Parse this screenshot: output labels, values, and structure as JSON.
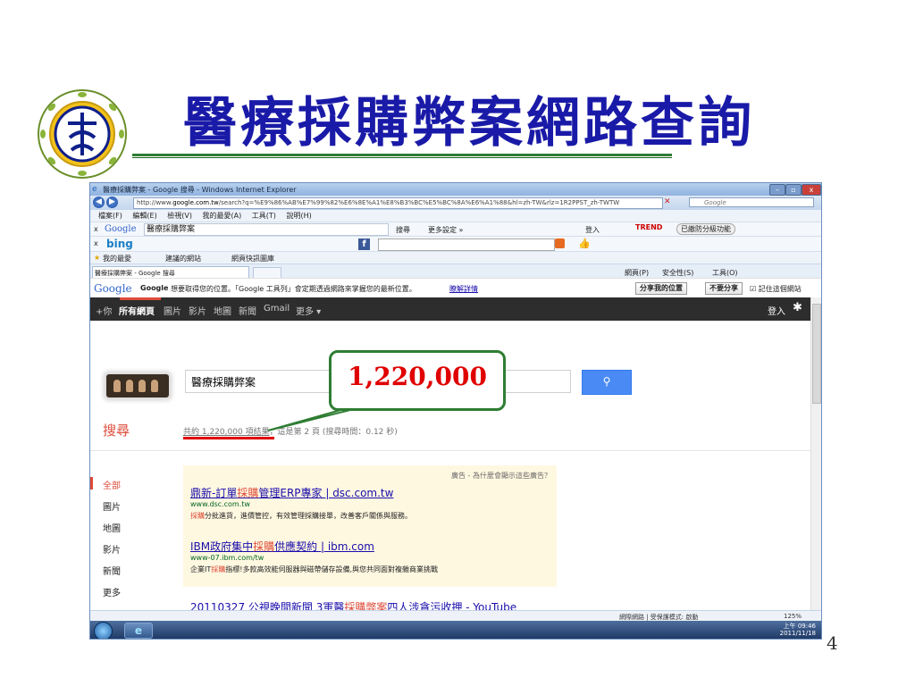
{
  "slide": {
    "title": "醫療採購弊案網路查詢",
    "page_number": "4"
  },
  "browser": {
    "window_title": "醫療採購弊案 - Google 搜尋 - Windows Internet Explorer",
    "url_prefix": "http://www.",
    "url_domain": "google.com.tw",
    "url_rest": "/search?q=%E9%86%AB%E7%99%82%E6%8E%A1%E8%B3%BC%E5%BC%8A%E6%A1%88&hl=zh-TW&rlz=1R2PPST_zh-TWTW",
    "search_box": "Google",
    "menu": [
      "檔案(F)",
      "編輯(E)",
      "檢視(V)",
      "我的最愛(A)",
      "工具(T)",
      "說明(H)"
    ],
    "google_toolbar": {
      "logo": "Google",
      "query": "醫療採購弊案",
      "search_label": "搜尋",
      "more_settings": "更多設定 »",
      "sign_in": "登入",
      "trend": "TREND",
      "blocked": "已繳防分級功能"
    },
    "bing_logo": "bing",
    "favorites": {
      "label": "我的最愛",
      "suggested": "建議的網站",
      "webslice": "網頁快訊圖庫"
    },
    "tab_label": "醫療採購弊案 - Google 搜尋",
    "command_bar": {
      "page": "網頁(P)",
      "safety": "安全性(S)",
      "tools": "工具(O)"
    },
    "notification": {
      "logo": "Google",
      "bold": "Google",
      "message": "想要取得您的位置。「Google 工具列」會定期透過網路來掌握您的最新位置。",
      "link": "瞭解詳情",
      "share_button": "分享我的位置",
      "deny_button": "不要分享",
      "remember": "記住這個網站"
    },
    "status": {
      "zone": "網際網路 | 受保護模式: 啟動",
      "zoom": "125%"
    },
    "tray": {
      "time": "上午 09:46",
      "date": "2011/11/18"
    }
  },
  "google": {
    "nav": [
      "+你",
      "所有網頁",
      "圖片",
      "影片",
      "地圖",
      "新聞",
      "Gmail",
      "更多 ▾"
    ],
    "sign_in": "登入",
    "query": "醫療採購弊案",
    "search_heading": "搜尋",
    "result_stats_underlined": "共約 1,220,000 項結果",
    "result_stats_rest": "，這是第 2 頁 (搜尋時間：0.12 秒)",
    "left_nav": [
      "全部",
      "圖片",
      "地圖",
      "影片",
      "新聞",
      "更多"
    ],
    "ad_label": "廣告 - 為什麼會顯示這些廣告？",
    "ads": [
      {
        "title_pre": "鼎新-訂單",
        "title_hl": "採購",
        "title_post": "管理ERP專家 | dsc.com.tw",
        "url": "www.dsc.com.tw",
        "desc_hl": "採購",
        "desc": "分批進貨，進價管控，有效管理採購接單，改善客戶關係與服務。"
      },
      {
        "title_pre": "IBM政府集中",
        "title_hl": "採購",
        "title_post": "供應契約 | ibm.com",
        "url": "www-07.ibm.com/tw",
        "desc_pre": "企業IT",
        "desc_hl": "採購",
        "desc": "指標!多款高效能伺服器與磁帶儲存設備,與您共同面對複雜商業挑戰"
      }
    ],
    "organic_pre": "20110327 公視晚間新聞 3軍醫",
    "organic_hl": "採購弊案",
    "organic_post": "四人涉貪污收押 - YouTube"
  },
  "callout": {
    "text": "1,220,000"
  },
  "colors": {
    "title": "#1a1aa8",
    "callout_border": "#2e7d32",
    "callout_text": "#e00000",
    "google_red": "#dd4b39",
    "link_blue": "#1a0dab"
  }
}
